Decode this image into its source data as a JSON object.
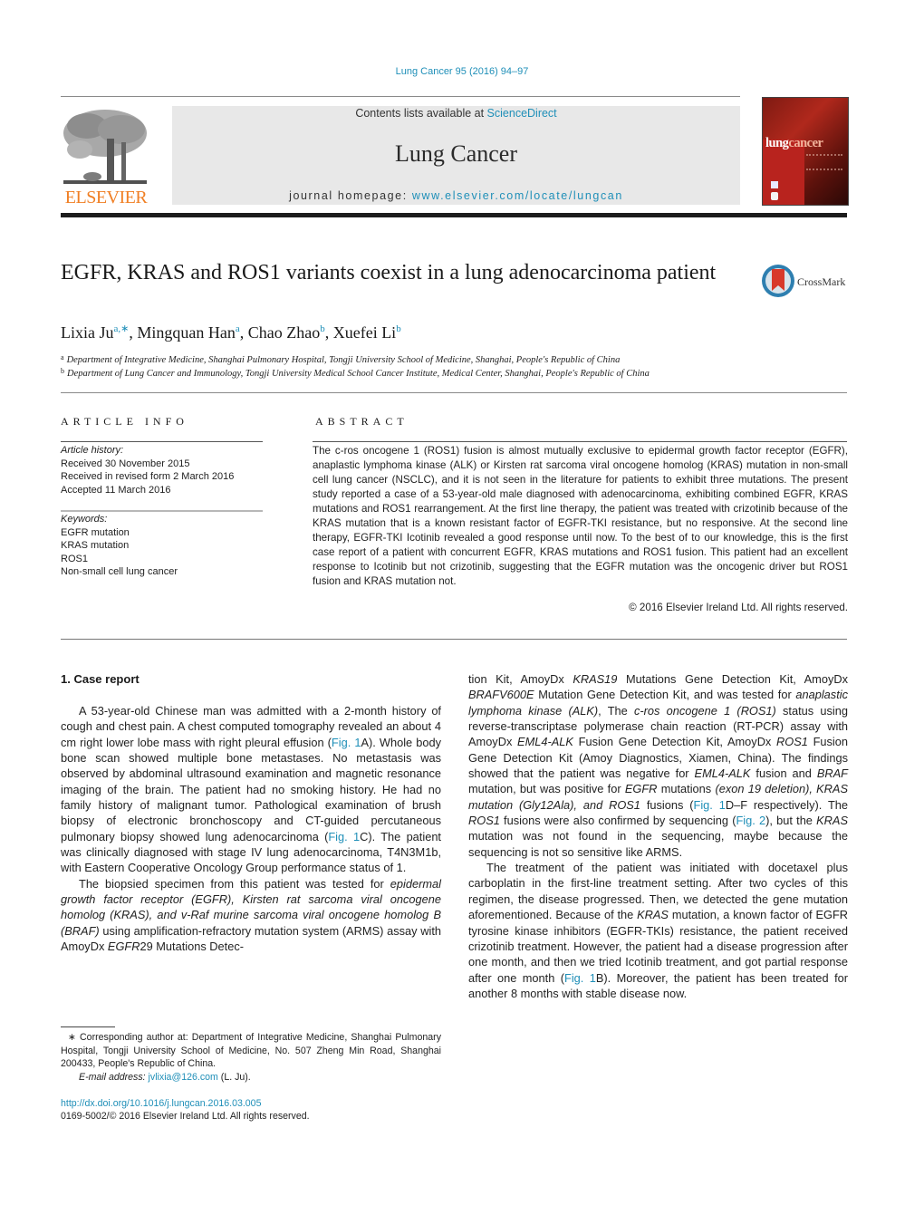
{
  "header": {
    "citation": "Lung Cancer 95 (2016) 94–97",
    "contents_prefix": "Contents lists available at ",
    "contents_link": "ScienceDirect",
    "journal_name": "Lung Cancer",
    "homepage_prefix": "journal homepage: ",
    "homepage_link": "www.elsevier.com/locate/lungcan",
    "publisher_logo_text": "ELSEVIER",
    "cover_title_a": "lung",
    "cover_title_b": "cancer",
    "colors": {
      "link": "#1f8fb8",
      "elsevier_orange": "#f07f24",
      "cover_red": "#b8231e"
    }
  },
  "article": {
    "title": "EGFR, KRAS and ROS1 variants coexist in a lung adenocarcinoma patient",
    "crossmark_label": "CrossMark",
    "authors": [
      {
        "name": "Lixia Ju",
        "sup": "a,∗"
      },
      {
        "name": "Mingquan Han",
        "sup": "a"
      },
      {
        "name": "Chao Zhao",
        "sup": "b"
      },
      {
        "name": "Xuefei Li",
        "sup": "b"
      }
    ],
    "affiliations": [
      {
        "sup": "a",
        "text": "Department of Integrative Medicine, Shanghai Pulmonary Hospital, Tongji University School of Medicine, Shanghai, People's Republic of China"
      },
      {
        "sup": "b",
        "text": "Department of Lung Cancer and Immunology, Tongji University Medical School Cancer Institute, Medical Center, Shanghai, People's Republic of China"
      }
    ]
  },
  "article_info": {
    "heading": "ARTICLE INFO",
    "history_label": "Article history:",
    "history": [
      "Received 30 November 2015",
      "Received in revised form 2 March 2016",
      "Accepted 11 March 2016"
    ],
    "keywords_label": "Keywords:",
    "keywords": [
      "EGFR mutation",
      "KRAS mutation",
      "ROS1",
      "Non-small cell lung cancer"
    ]
  },
  "abstract": {
    "heading": "ABSTRACT",
    "text": "The c-ros oncogene 1 (ROS1) fusion is almost mutually exclusive to epidermal growth factor receptor (EGFR), anaplastic lymphoma kinase (ALK) or Kirsten rat sarcoma viral oncogene homolog (KRAS) mutation in non-small cell lung cancer (NSCLC), and it is not seen in the literature for patients to exhibit three mutations. The present study reported a case of a 53-year-old male diagnosed with adenocarcinoma, exhibiting combined EGFR, KRAS mutations and ROS1 rearrangement. At the first line therapy, the patient was treated with crizotinib because of the KRAS mutation that is a known resistant factor of EGFR-TKI resistance, but no responsive. At the second line therapy, EGFR-TKI Icotinib revealed a good response until now. To the best of to our knowledge, this is the first case report of a patient with concurrent EGFR, KRAS mutations and ROS1 fusion. This patient had an excellent response to Icotinib but not crizotinib, suggesting that the EGFR mutation was the oncogenic driver but ROS1 fusion and KRAS mutation not.",
    "copyright": "© 2016 Elsevier Ireland Ltd. All rights reserved."
  },
  "body": {
    "section_heading": "1.  Case report",
    "p1": {
      "a": "A 53-year-old Chinese man was admitted with a 2-month history of cough and chest pain. A chest computed tomography revealed an about 4 cm right lower lobe mass with right pleural effusion (",
      "link1": "Fig. 1",
      "b": "A). Whole body bone scan showed multiple bone metastases. No metastasis was observed by abdominal ultrasound examination and magnetic resonance imaging of the brain. The patient had no smoking history. He had no family history of malignant tumor. Pathological examination of brush biopsy of electronic bronchoscopy and CT-guided percutaneous pulmonary biopsy showed lung adenocarcinoma (",
      "link2": "Fig. 1",
      "c": "C). The patient was clinically diagnosed with stage IV lung adenocarcinoma, T4N3M1b, with Eastern Cooperative Oncology Group performance status of 1."
    },
    "p2": {
      "a": "The biopsied specimen from this patient was tested for ",
      "i1": "epidermal growth factor receptor (EGFR), Kirsten rat sarcoma viral oncogene homolog (KRAS), and v-Raf murine sarcoma viral oncogene homolog B (BRAF)",
      "b": " using amplification-refractory mutation system (ARMS) assay with AmoyDx ",
      "i2": "EGFR",
      "c": "29 Mutations Detection Kit, AmoyDx ",
      "i3": "KRAS19",
      "d": " Mutations Gene Detection Kit, AmoyDx ",
      "i4": "BRAFV600E",
      "e": " Mutation Gene Detection Kit, and was tested for ",
      "i5": "anaplastic lymphoma kinase (ALK)",
      "f": ", The ",
      "i6": "c-ros oncogene 1 (ROS1)",
      "g": " status using reverse-transcriptase polymerase chain reaction (RT-PCR) assay with AmoyDx ",
      "i7": "EML4-ALK",
      "h": " Fusion Gene Detection Kit, AmoyDx ",
      "i8": "ROS1",
      "j": " Fusion Gene Detection Kit (Amoy Diagnostics, Xiamen, China). The findings showed that the patient was negative for ",
      "i9": "EML4-ALK",
      "k": " fusion and ",
      "i10": "BRAF",
      "l": " mutation, but was positive for ",
      "i11": "EGFR",
      "m": " mutations ",
      "i12": "(exon 19 deletion), KRAS mutation (Gly12Ala), and ROS1",
      "n": " fusions (",
      "link1": "Fig. 1",
      "o": "D–F respectively). The ",
      "i13": "ROS1",
      "p": " fusions were also confirmed by sequencing (",
      "link2": "Fig. 2",
      "q": "), but the ",
      "i14": "KRAS",
      "r": " mutation was not found in the sequencing, maybe because the sequencing is not so sensitive like ARMS."
    },
    "p3": {
      "a": "The treatment of the patient was initiated with docetaxel plus carboplatin in the first-line treatment setting. After two cycles of this regimen, the disease progressed. Then, we detected the gene mutation aforementioned. Because of the ",
      "i1": "KRAS",
      "b": " mutation, a known factor of EGFR tyrosine kinase inhibitors (EGFR-TKIs) resistance, the patient received crizotinib treatment. However, the patient had a disease progression after one month, and then we tried Icotinib treatment, and got partial response after one month (",
      "link1": "Fig. 1",
      "c": "B). Moreover, the patient has been treated for another 8 months with stable disease now."
    }
  },
  "footnotes": {
    "corresponding": "∗  Corresponding author at: Department of Integrative Medicine, Shanghai Pulmonary Hospital, Tongji University School of Medicine, No. 507 Zheng Min Road, Shanghai 200433, People's Republic of China.",
    "email_label": "E-mail address: ",
    "email": "jvlixia@126.com",
    "email_suffix": " (L. Ju).",
    "doi": "http://dx.doi.org/10.1016/j.lungcan.2016.03.005",
    "issn": "0169-5002/© 2016 Elsevier Ireland Ltd. All rights reserved."
  }
}
